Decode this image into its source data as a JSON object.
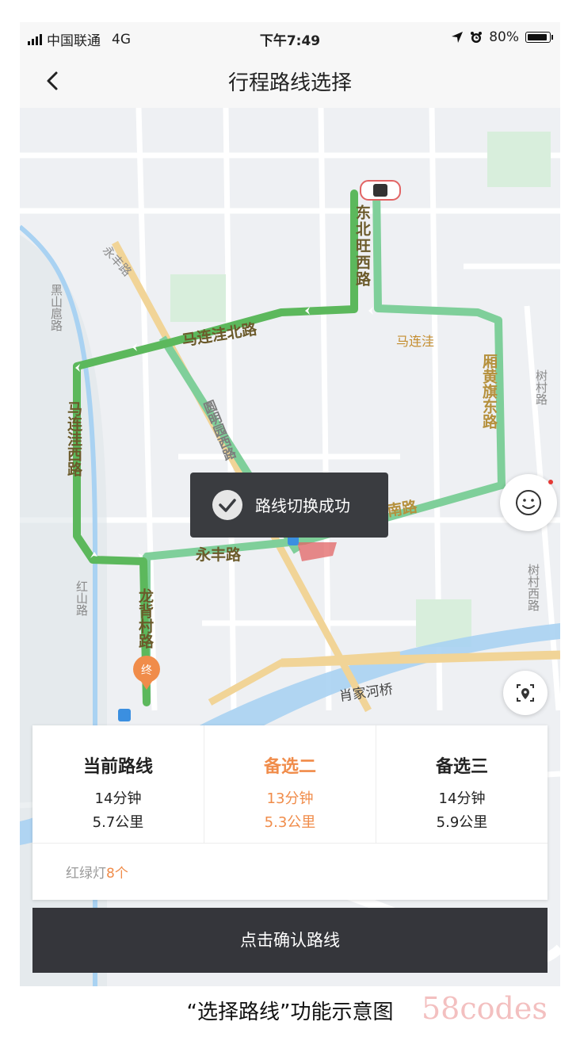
{
  "status_bar": {
    "carrier": "中国联通",
    "network": "4G",
    "time": "下午7:49",
    "battery": "80%"
  },
  "nav": {
    "title": "行程路线选择"
  },
  "map": {
    "roads": [
      "东北旺西路",
      "马连洼北路",
      "马连洼",
      "厢黄旗东路",
      "树村路",
      "黑山扈路",
      "永丰路",
      "马连洼西路",
      "圆明园西路",
      "天秀路",
      "大南路",
      "树村西路",
      "红山路",
      "龙背村路",
      "肖家河桥"
    ],
    "end_marker": "终",
    "route_color": "#5cb85c",
    "alt_route_color": "#7fcf9a"
  },
  "toast": {
    "text": "路线切换成功"
  },
  "route_options": [
    {
      "name": "当前路线",
      "time": "14分钟",
      "distance": "5.7公里",
      "selected": false
    },
    {
      "name": "备选二",
      "time": "13分钟",
      "distance": "5.3公里",
      "selected": true
    },
    {
      "name": "备选三",
      "time": "14分钟",
      "distance": "5.9公里",
      "selected": false
    }
  ],
  "traffic_lights": {
    "label": "红绿灯",
    "count": "8个"
  },
  "confirm_button": {
    "label": "点击确认路线"
  },
  "caption": "“选择路线”功能示意图",
  "watermark": "58codes",
  "accent_color": "#f08c4a"
}
